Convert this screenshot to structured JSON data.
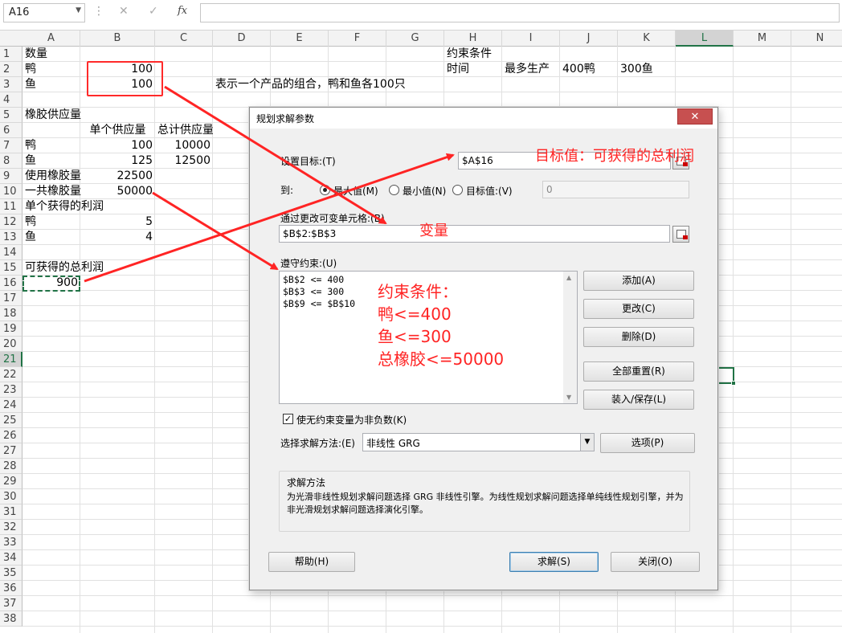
{
  "formula_bar": {
    "name_box": "A16",
    "cancel_glyph": "✕",
    "enter_glyph": "✓",
    "fx_label": "fx",
    "formula_value": ""
  },
  "columns": [
    "A",
    "B",
    "C",
    "D",
    "E",
    "F",
    "G",
    "H",
    "I",
    "J",
    "K",
    "L",
    "M",
    "N"
  ],
  "selected_column": "L",
  "rows": [
    "1",
    "2",
    "3",
    "4",
    "5",
    "6",
    "7",
    "8",
    "9",
    "10",
    "11",
    "12",
    "13",
    "14",
    "15",
    "16",
    "17",
    "18",
    "19",
    "20",
    "21",
    "22",
    "23",
    "24",
    "25",
    "26",
    "27",
    "28",
    "29",
    "30",
    "31",
    "32",
    "33",
    "34",
    "35",
    "36",
    "37",
    "38"
  ],
  "selected_row": "21",
  "cells": {
    "A1": "数量",
    "A2": "鸭",
    "B2": "100",
    "A3": "鱼",
    "B3": "100",
    "D3": "表示一个产品的组合，鸭和鱼各100只",
    "H1": "约束条件",
    "H2": "时间",
    "I2": "最多生产",
    "J2": "400鸭",
    "K2": "300鱼",
    "A5": "橡胶供应量",
    "B6": "单个供应量",
    "C6": "总计供应量",
    "A7": "鸭",
    "B7": "100",
    "C7": "10000",
    "A8": "鱼",
    "B8": "125",
    "C8": "12500",
    "A9": "使用橡胶量",
    "B9": "22500",
    "A10": "一共橡胶量",
    "B10": "50000",
    "A11": "单个获得的利润",
    "A12": "鸭",
    "B12": "5",
    "A13": "鱼",
    "B13": "4",
    "A15": "可获得的总利润",
    "A16": "900"
  },
  "dialog": {
    "title": "规划求解参数",
    "close_glyph": "✕",
    "set_objective_label": "设置目标:(T)",
    "objective_value": "$A$16",
    "to_label": "到:",
    "radio_max": "最大值(M)",
    "radio_min": "最小值(N)",
    "radio_value": "目标值:(V)",
    "target_value": "0",
    "by_changing_label": "通过更改可变单元格:(B)",
    "changing_cells": "$B$2:$B$3",
    "subject_to_label": "遵守约束:(U)",
    "constraints": [
      "$B$2 <= 400",
      "$B$3 <= 300",
      "$B$9 <= $B$10"
    ],
    "btn_add": "添加(A)",
    "btn_change": "更改(C)",
    "btn_delete": "删除(D)",
    "btn_reset": "全部重置(R)",
    "btn_load_save": "装入/保存(L)",
    "nonneg_label": "使无约束变量为非负数(K)",
    "method_label": "选择求解方法:(E)",
    "method_value": "非线性 GRG",
    "btn_options": "选项(P)",
    "method_group_title": "求解方法",
    "method_description": "为光滑非线性规划求解问题选择 GRG 非线性引擎。为线性规划求解问题选择单纯线性规划引擎，并为非光滑规划求解问题选择演化引擎。",
    "btn_help": "帮助(H)",
    "btn_solve": "求解(S)",
    "btn_close": "关闭(O)"
  },
  "annotations": {
    "objective_note": "目标值：可获得的总利润",
    "variables_note": "变量",
    "constraints_title": "约束条件：",
    "constraint_note_1": "鸭<=400",
    "constraint_note_2": "鱼<=300",
    "constraint_note_3": "总橡胶<=50000",
    "color": "#ff2424"
  },
  "colors": {
    "excel_green": "#217346",
    "annotation_red": "#ff2424"
  }
}
